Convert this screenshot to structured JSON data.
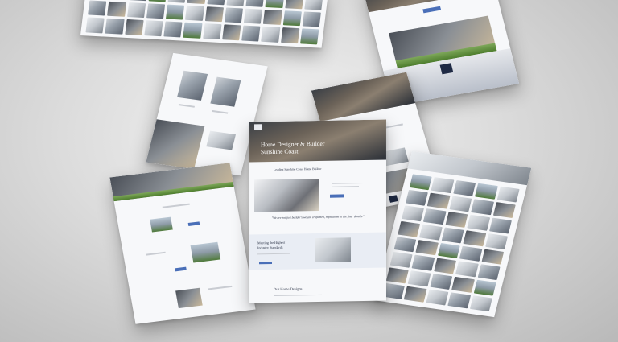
{
  "hero": {
    "title_line1": "Home Designer & Builder",
    "title_line2": "Sunshine Coast",
    "subtitle": "Leading Sunshine Coast Home Builder"
  },
  "quote": "\"We are not just builder's we are craftsmen, right down to the finer details.\"",
  "section_standards": {
    "title_line1": "Meeting the Highest",
    "title_line2": "Industry Standards"
  },
  "section_designs": {
    "title": "Our Home Designs"
  },
  "colors": {
    "navy": "#1f2a44",
    "accent": "#4a6fb8",
    "grass": "#5f8f3a"
  }
}
